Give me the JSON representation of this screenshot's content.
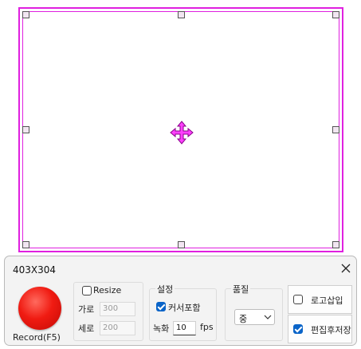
{
  "panel": {
    "title": "403X304",
    "record_label": "Record(F5)",
    "resize": {
      "label": "Resize",
      "checked": false,
      "width_label": "가로",
      "width_value": "300",
      "height_label": "세로",
      "height_value": "200"
    },
    "settings": {
      "title": "설정",
      "cursor_label": "커서포함",
      "cursor_checked": true,
      "record_label": "녹화",
      "fps_value": "10",
      "fps_unit": "fps"
    },
    "quality": {
      "title": "품질",
      "selected": "중"
    },
    "buttons": {
      "logo_insert": "로고삽입",
      "logo_checked": false,
      "save_after_edit": "편집후저장",
      "save_after_edit_checked": true
    }
  },
  "colors": {
    "frame": "#e020e0",
    "record": "#f01b12",
    "checkbox_checked": "#0a64c8"
  },
  "icons": {
    "move": "move-arrows-icon",
    "close": "close-icon",
    "chevron": "chevron-down-icon"
  }
}
